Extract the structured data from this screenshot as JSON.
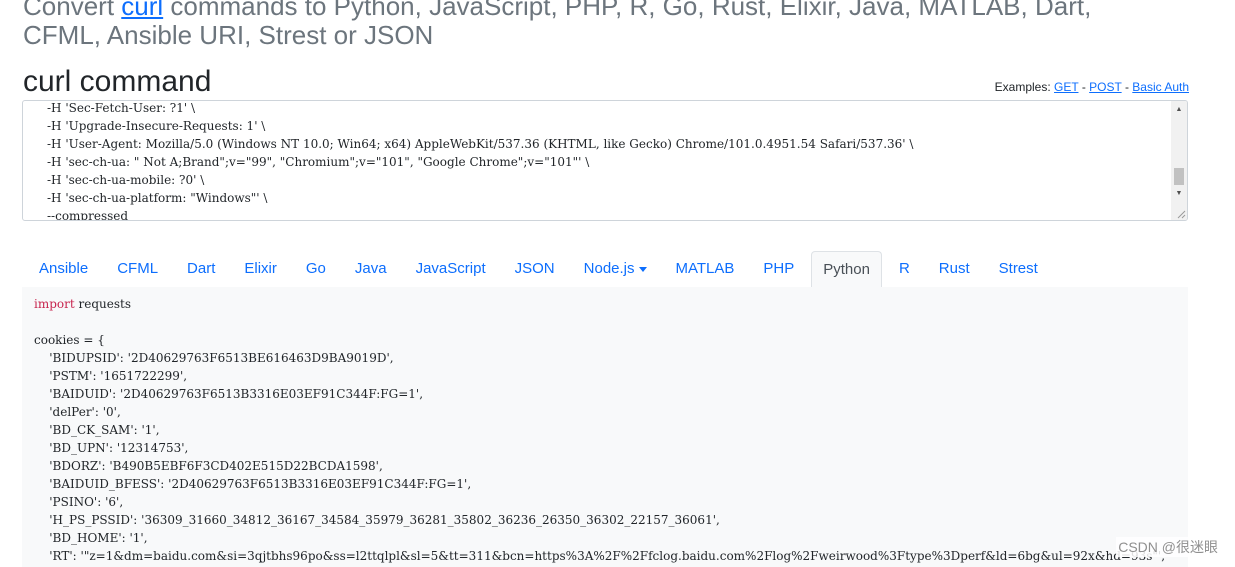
{
  "header": {
    "title_prefix": "Convert ",
    "title_link": "curl",
    "title_rest": " commands to Python, JavaScript, PHP, R, Go, Rust, Elixir, Java, MATLAB, Dart, CFML, Ansible URI, Strest or JSON"
  },
  "curl_section": {
    "title": "curl command",
    "examples_label": "Examples: ",
    "examples": [
      "GET",
      "POST",
      "Basic Auth"
    ],
    "separator": " - ",
    "lines": [
      "-H 'Sec-Fetch-User: ?1' \\",
      "-H 'Upgrade-Insecure-Requests: 1' \\",
      "-H 'User-Agent: Mozilla/5.0 (Windows NT 10.0; Win64; x64) AppleWebKit/537.36 (KHTML, like Gecko) Chrome/101.0.4951.54 Safari/537.36' \\",
      "-H 'sec-ch-ua: \" Not A;Brand\";v=\"99\", \"Chromium\";v=\"101\", \"Google Chrome\";v=\"101\"' \\",
      "-H 'sec-ch-ua-mobile: ?0' \\",
      "-H 'sec-ch-ua-platform: \"Windows\"' \\",
      "--compressed"
    ]
  },
  "tabs": [
    {
      "label": "Ansible"
    },
    {
      "label": "CFML"
    },
    {
      "label": "Dart"
    },
    {
      "label": "Elixir"
    },
    {
      "label": "Go"
    },
    {
      "label": "Java"
    },
    {
      "label": "JavaScript"
    },
    {
      "label": "JSON"
    },
    {
      "label": "Node.js",
      "dropdown": true
    },
    {
      "label": "MATLAB"
    },
    {
      "label": "PHP"
    },
    {
      "label": "Python",
      "active": true
    },
    {
      "label": "R"
    },
    {
      "label": "Rust"
    },
    {
      "label": "Strest"
    }
  ],
  "code": {
    "import_keyword": "import",
    "import_module": " requests",
    "lines": [
      "",
      "cookies = {",
      "    'BIDUPSID': '2D40629763F6513BE616463D9BA9019D',",
      "    'PSTM': '1651722299',",
      "    'BAIDUID': '2D40629763F6513B3316E03EF91C344F:FG=1',",
      "    'delPer': '0',",
      "    'BD_CK_SAM': '1',",
      "    'BD_UPN': '12314753',",
      "    'BDORZ': 'B490B5EBF6F3CD402E515D22BCDA1598',",
      "    'BAIDUID_BFESS': '2D40629763F6513B3316E03EF91C344F:FG=1',",
      "    'PSINO': '6',",
      "    'H_PS_PSSID': '36309_31660_34812_36167_34584_35979_36281_35802_36236_26350_36302_22157_36061',",
      "    'BD_HOME': '1',",
      "    'RT': '\"z=1&dm=baidu.com&si=3qjtbhs96po&ss=l2ttqlpl&sl=5&tt=311&bcn=https%3A%2F%2Ffclog.baidu.com%2Flog%2Fweirwood%3Ftype%3Dperf&ld=6bg&ul=92x&hd=93s\"',"
    ]
  },
  "watermark": "CSDN @很迷眼"
}
